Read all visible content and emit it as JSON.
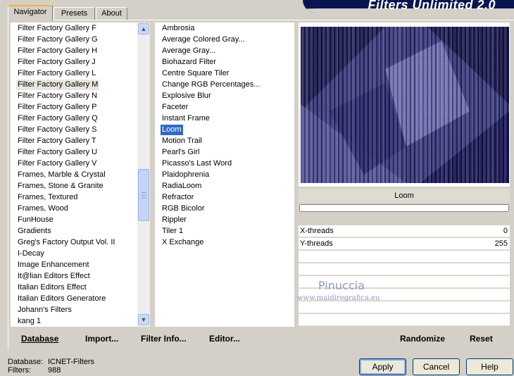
{
  "app_title": "Filters Unlimited 2.0",
  "tabs": [
    {
      "label": "Navigator"
    },
    {
      "label": "Presets"
    },
    {
      "label": "About"
    }
  ],
  "categories": [
    "Filter Factory Gallery F",
    "Filter Factory Gallery G",
    "Filter Factory Gallery H",
    "Filter Factory Gallery J",
    "Filter Factory Gallery L",
    "Filter Factory Gallery M",
    "Filter Factory Gallery N",
    "Filter Factory Gallery P",
    "Filter Factory Gallery Q",
    "Filter Factory Gallery S",
    "Filter Factory Gallery T",
    "Filter Factory Gallery U",
    "Filter Factory Gallery V",
    "Frames, Marble & Crystal",
    "Frames, Stone & Granite",
    "Frames, Textured",
    "Frames, Wood",
    "FunHouse",
    "Gradients",
    "Greg's Factory Output Vol. II",
    "I-Decay",
    "Image Enhancement",
    "It@lian Editors Effect",
    "Italian Editors Effect",
    "Italian Editors Generatore",
    "Johann's Filters",
    "kang 1"
  ],
  "selected_category": "Filter Factory Gallery M",
  "filters": [
    "Ambrosia",
    "Average Colored Gray...",
    "Average Gray...",
    "Biohazard Filter",
    "Centre Square Tiler",
    "Change RGB Percentages...",
    "Explosive Blur",
    "Faceter",
    "Instant Frame",
    "Loom",
    "Motion Trail",
    "Pearl's Girl",
    "Picasso's Last Word",
    "Plaidophrenia",
    "RadiaLoom",
    "Refractor",
    "RGB Bicolor",
    "Rippler",
    "Tiler 1",
    "X Exchange"
  ],
  "selected_filter": "Loom",
  "filter_name": "Loom",
  "params": [
    {
      "label": "X-threads",
      "value": "0"
    },
    {
      "label": "Y-threads",
      "value": "255"
    }
  ],
  "watermark": {
    "line1": "Pinuccia",
    "line2": "www.maidiregrafica.eu"
  },
  "toolbar": {
    "database": "Database",
    "import": "Import...",
    "filter_info": "Filter Info...",
    "editor": "Editor...",
    "randomize": "Randomize",
    "reset": "Reset"
  },
  "status": {
    "database_label": "Database:",
    "database_value": "ICNET-Filters",
    "filters_label": "Filters:",
    "filters_value": "988"
  },
  "buttons": {
    "apply": "Apply",
    "cancel": "Cancel",
    "help": "Help"
  },
  "colors": {
    "banner": "#0a1450",
    "selection": "#316ac5",
    "preview_dark": "#0b0b3a"
  }
}
